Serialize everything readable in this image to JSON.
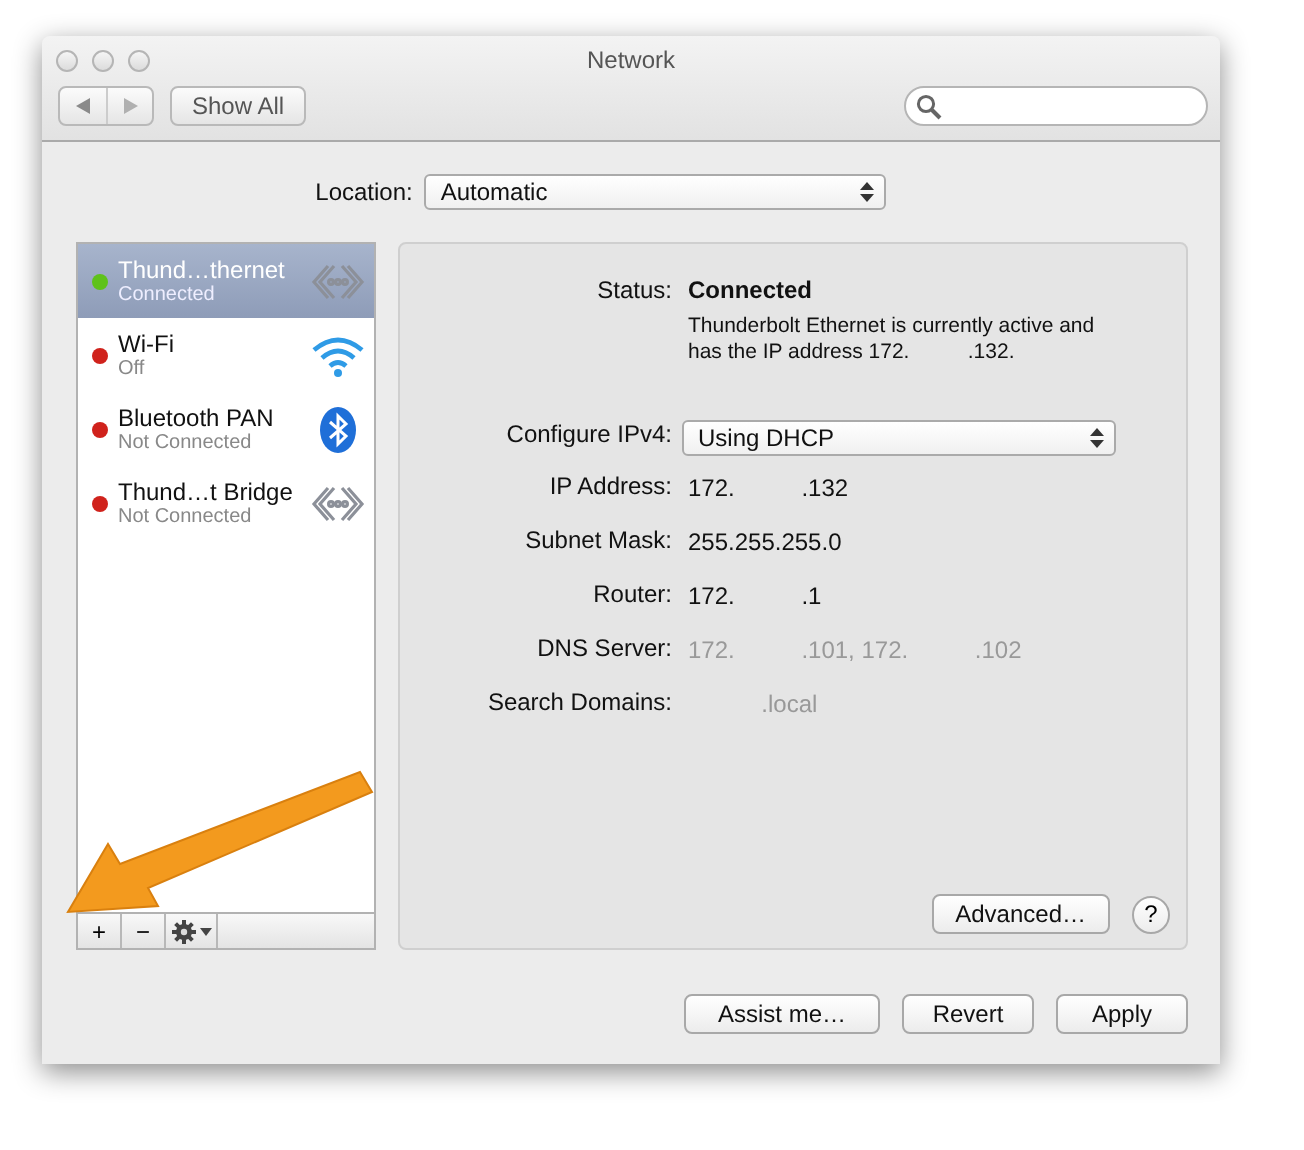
{
  "window": {
    "title": "Network"
  },
  "toolbar": {
    "show_all": "Show All"
  },
  "location": {
    "label": "Location:",
    "value": "Automatic"
  },
  "services": [
    {
      "name": "Thund…thernet",
      "status": "Connected",
      "color": "#5fc21a",
      "kind": "ethernet",
      "selected": true
    },
    {
      "name": "Wi-Fi",
      "status": "Off",
      "color": "#d0221c",
      "kind": "wifi",
      "selected": false
    },
    {
      "name": "Bluetooth PAN",
      "status": "Not Connected",
      "color": "#d0221c",
      "kind": "bluetooth",
      "selected": false
    },
    {
      "name": "Thund…t Bridge",
      "status": "Not Connected",
      "color": "#d0221c",
      "kind": "ethernet",
      "selected": false
    }
  ],
  "service_actions": {
    "add": "+",
    "remove": "−"
  },
  "details": {
    "status_label": "Status:",
    "status_value": "Connected",
    "status_note": "Thunderbolt Ethernet is currently active and has the IP address 172.          .132.",
    "configure": {
      "label": "Configure IPv4:",
      "value": "Using DHCP"
    },
    "fields": [
      {
        "label": "IP Address:",
        "value": "172.          .132",
        "dimmed": false
      },
      {
        "label": "Subnet Mask:",
        "value": "255.255.255.0",
        "dimmed": false
      },
      {
        "label": "Router:",
        "value": "172.          .1",
        "dimmed": false
      },
      {
        "label": "DNS Server:",
        "value": "172.          .101, 172.          .102",
        "dimmed": true
      },
      {
        "label": "Search Domains:",
        "value": "           .local",
        "dimmed": true
      }
    ],
    "advanced": "Advanced…",
    "help": "?"
  },
  "buttons": [
    "Assist me…",
    "Revert",
    "Apply"
  ]
}
